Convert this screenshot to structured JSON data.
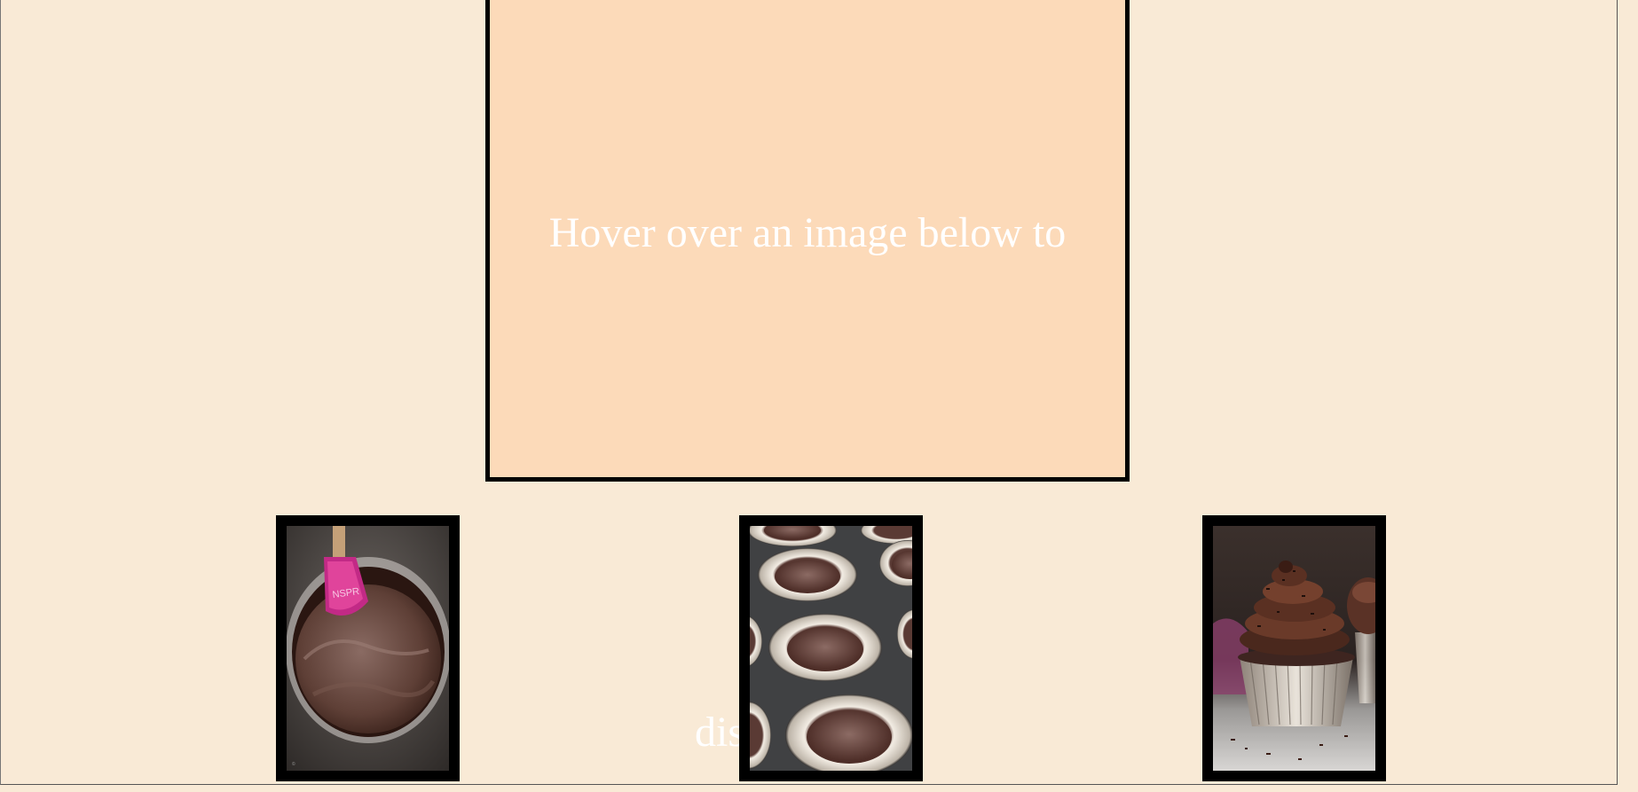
{
  "display": {
    "text": "Hover over an image below to",
    "overflow_text": "dis",
    "background": "#fcdab9",
    "border_color": "#000000"
  },
  "page": {
    "background": "#f9ead6"
  },
  "thumbnails": [
    {
      "name": "chocolate-batter-bowl-image",
      "alt": "Chocolate cupcake batter in a glass bowl with a pink spatula"
    },
    {
      "name": "cupcake-liners-batter-image",
      "alt": "Muffin tin with liners filled with chocolate batter"
    },
    {
      "name": "frosted-chocolate-cupcake-image",
      "alt": "Chocolate cupcake with swirled chocolate frosting and sprinkles"
    }
  ]
}
